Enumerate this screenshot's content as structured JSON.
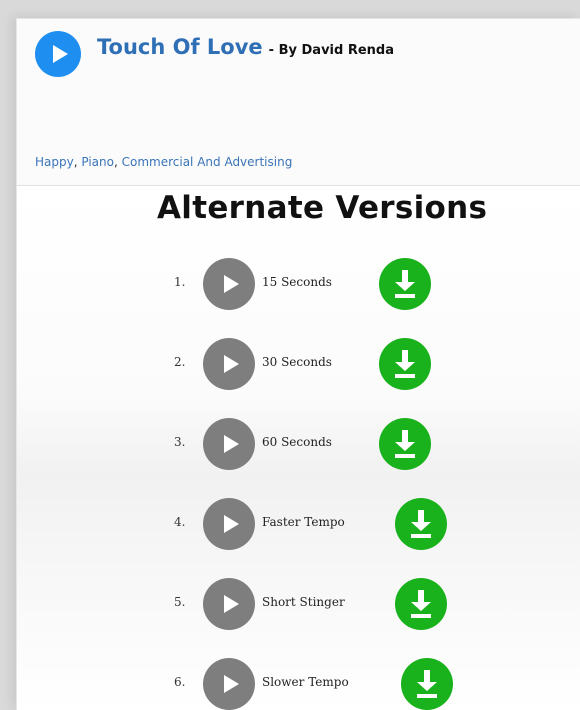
{
  "song": {
    "title": "Touch Of Love",
    "by_artist": "- By David Renda"
  },
  "tags": [
    {
      "label": "Happy",
      "sep": ", "
    },
    {
      "label": "Piano",
      "sep": ", "
    },
    {
      "label": "Commercial And Advertising",
      "sep": ""
    }
  ],
  "alternate_versions": {
    "heading": "Alternate Versions",
    "items": [
      {
        "number": "1.",
        "label": "15 Seconds"
      },
      {
        "number": "2.",
        "label": "30 Seconds"
      },
      {
        "number": "3.",
        "label": "60 Seconds"
      },
      {
        "number": "4.",
        "label": "Faster Tempo"
      },
      {
        "number": "5.",
        "label": "Short Stinger"
      },
      {
        "number": "6.",
        "label": "Slower Tempo"
      }
    ]
  },
  "icons": {
    "main_play": "play-icon",
    "version_play": "play-icon",
    "version_download": "download-icon"
  },
  "colors": {
    "title_blue": "#2f6fb6",
    "main_play_blue": "#1e8ff1",
    "play_gray": "#7e7e7e",
    "download_green": "#1ab21c",
    "tag_link": "#3a74b8"
  }
}
